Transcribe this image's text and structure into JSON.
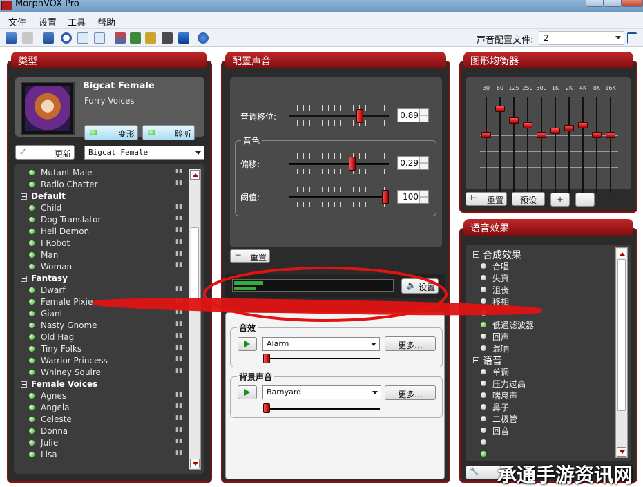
{
  "window": {
    "title": "MorphVOX Pro"
  },
  "menu": [
    "文件",
    "设置",
    "工具",
    "帮助"
  ],
  "toolbar": {
    "profile_label": "声音配置文件:",
    "profile_value": "2"
  },
  "type_panel": {
    "header": "类型",
    "voice_name": "Bigcat Female",
    "voice_category": "Furry Voices",
    "morph_button": "变形",
    "listen_button": "聆听",
    "update_button": "更新",
    "voice_combo": "Bigcat Female",
    "list": [
      {
        "kind": "item",
        "label": "Mutant Male"
      },
      {
        "kind": "item",
        "label": "Radio Chatter"
      },
      {
        "kind": "group",
        "label": "Default"
      },
      {
        "kind": "item",
        "label": "Child"
      },
      {
        "kind": "item",
        "label": "Dog Translator"
      },
      {
        "kind": "item",
        "label": "Hell Demon"
      },
      {
        "kind": "item",
        "label": "I Robot"
      },
      {
        "kind": "item",
        "label": "Man"
      },
      {
        "kind": "item",
        "label": "Woman"
      },
      {
        "kind": "group",
        "label": "Fantasy"
      },
      {
        "kind": "item",
        "label": "Dwarf"
      },
      {
        "kind": "item",
        "label": "Female Pixie"
      },
      {
        "kind": "item",
        "label": "Giant"
      },
      {
        "kind": "item",
        "label": "Nasty Gnome"
      },
      {
        "kind": "item",
        "label": "Old Hag"
      },
      {
        "kind": "item",
        "label": "Tiny Folks"
      },
      {
        "kind": "item",
        "label": "Warrior Princess"
      },
      {
        "kind": "item",
        "label": "Whiney Squire"
      },
      {
        "kind": "group",
        "label": "Female Voices"
      },
      {
        "kind": "item",
        "label": "Agnes"
      },
      {
        "kind": "item",
        "label": "Angela"
      },
      {
        "kind": "item",
        "label": "Celeste"
      },
      {
        "kind": "item",
        "label": "Donna"
      },
      {
        "kind": "item",
        "label": "Julie"
      },
      {
        "kind": "item",
        "label": "Lisa"
      }
    ]
  },
  "config_panel": {
    "header": "配置声音",
    "pitch_label": "音调移位:",
    "pitch_value": "0.89",
    "timbre_group": "音色",
    "offset_label": "偏移:",
    "offset_value": "0.29",
    "threshold_label": "阈值:",
    "threshold_value": "100",
    "reset_button": "重置",
    "settings_button": "设置",
    "sfx_group": "音效",
    "sfx_combo": "Alarm",
    "more_button": "更多...",
    "bg_group": "背景声音",
    "bg_combo": "Barnyard",
    "bg_more_button": "更多..."
  },
  "eq_panel": {
    "header": "图形均衡器",
    "bands": [
      "30",
      "60",
      "125",
      "250",
      "500",
      "1K",
      "2K",
      "4K",
      "8K",
      "16K"
    ],
    "levels": [
      0,
      0.55,
      0.3,
      0.2,
      0,
      0.08,
      0.15,
      0.2,
      0,
      0
    ],
    "reset_button": "重置",
    "preset_button": "预设",
    "plus_button": "+",
    "minus_button": "-"
  },
  "effects_panel": {
    "header": "语音效果",
    "list": [
      {
        "kind": "group",
        "label": "合成效果"
      },
      {
        "kind": "item",
        "label": "合唱",
        "on": false
      },
      {
        "kind": "item",
        "label": "失真",
        "on": false
      },
      {
        "kind": "item",
        "label": "沮丧",
        "on": false
      },
      {
        "kind": "item",
        "label": "移相",
        "on": false
      },
      {
        "kind": "item",
        "label": "",
        "on": false
      },
      {
        "kind": "item",
        "label": "低通滤波器",
        "on": true
      },
      {
        "kind": "item",
        "label": "回声",
        "on": false
      },
      {
        "kind": "item",
        "label": "混响",
        "on": false
      },
      {
        "kind": "group",
        "label": "语音"
      },
      {
        "kind": "item",
        "label": "单调",
        "on": false
      },
      {
        "kind": "item",
        "label": "压力过高",
        "on": false
      },
      {
        "kind": "item",
        "label": "喘息声",
        "on": false
      },
      {
        "kind": "item",
        "label": "鼻子",
        "on": false
      },
      {
        "kind": "item",
        "label": "二极管",
        "on": false
      },
      {
        "kind": "item",
        "label": "回音",
        "on": false
      },
      {
        "kind": "item",
        "label": "",
        "on": false
      },
      {
        "kind": "item",
        "label": "",
        "on": true
      }
    ]
  },
  "watermark": "承通手游资讯网"
}
